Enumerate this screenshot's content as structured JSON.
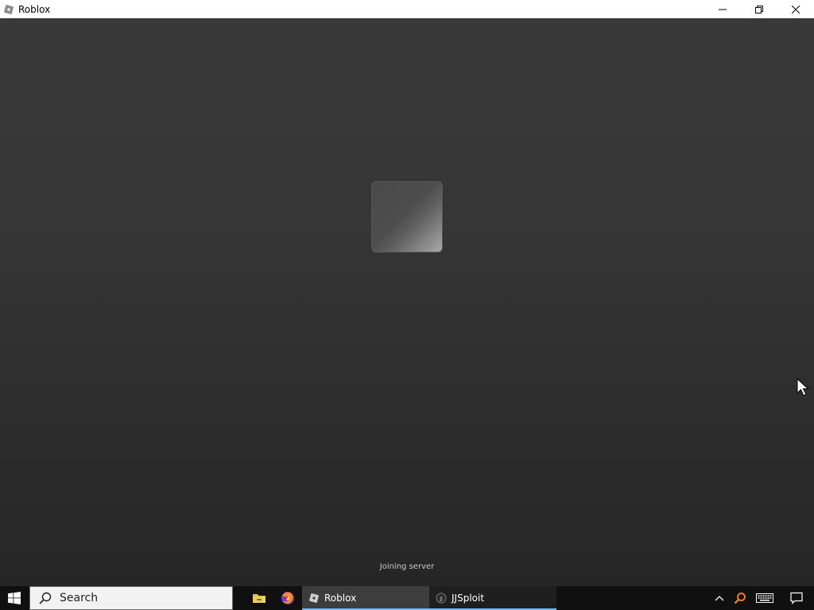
{
  "window": {
    "title": "Roblox",
    "icon": "roblox-icon",
    "controls": [
      "minimize-icon",
      "restore-icon",
      "close-icon"
    ]
  },
  "game": {
    "status_text": "Joining server",
    "loading_tile_icon": "loading-tile"
  },
  "taskbar": {
    "start_icon": "windows-start-icon",
    "search_placeholder": "Search",
    "pinned": [
      {
        "name": "file-explorer-icon"
      },
      {
        "name": "firefox-icon"
      }
    ],
    "tasks": [
      {
        "label": "Roblox",
        "icon": "roblox-icon",
        "active": true
      },
      {
        "label": "JJSploit",
        "icon": "jjsploit-icon",
        "active": false
      }
    ],
    "tray": [
      "chevron-up-icon",
      "search-tray-icon",
      "keyboard-icon",
      "notification-icon"
    ]
  },
  "colors": {
    "accent": "#76b9ed",
    "taskbar": "#101010",
    "viewport": "#363636"
  }
}
